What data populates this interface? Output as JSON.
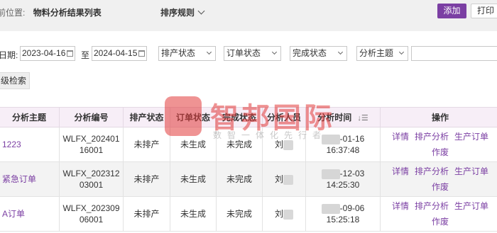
{
  "breadcrumb": {
    "prefix": "前位置:",
    "title": "物料分析结果列表"
  },
  "sort_menu": {
    "label": "排序规则"
  },
  "toolbar": {
    "add_label": "添加",
    "print_label": "打印"
  },
  "filters": {
    "date_label": "日期:",
    "date_from": "2023-04-16",
    "to_label": "至",
    "date_to": "2024-04-15",
    "production_status": "排产状态",
    "order_status": "订单状态",
    "completion_status": "完成状态",
    "analysis_topic": "分析主题"
  },
  "advanced_search_label": "级检索",
  "watermark": {
    "title": "智邦国际",
    "subtitle": "数智一体化先行者"
  },
  "table": {
    "headers": [
      "分析主题",
      "分析编号",
      "排产状态",
      "订单状态",
      "完成状态",
      "分析人员",
      "分析时间",
      "操作"
    ],
    "rows": [
      {
        "topic": "1223",
        "code": "WLFX_20240116001",
        "production": "未排产",
        "order": "未生成",
        "completion": "未完成",
        "person": "刘",
        "time": "-01-16 16:37:48"
      },
      {
        "topic": "紧急订单",
        "code": "WLFX_20231203001",
        "production": "未排产",
        "order": "未生成",
        "completion": "未完成",
        "person": "刘",
        "time": "-12-03 14:25:30"
      },
      {
        "topic": "A订单",
        "code": "WLFX_20230906001",
        "production": "未排产",
        "order": "未生成",
        "completion": "未完成",
        "person": "刘",
        "time": "-09-06 15:25:18"
      }
    ],
    "actions": {
      "detail": "详情",
      "production_analysis": "排产分析",
      "production_order": "生产订单",
      "void": "作废"
    }
  },
  "colors": {
    "accent": "#7b3fa3",
    "header_bg": "#f7eef7",
    "watermark": "#e23b3b"
  }
}
